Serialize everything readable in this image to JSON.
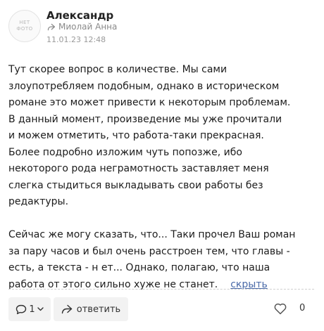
{
  "avatar": {
    "line1": "НЕТ",
    "line2": "ФОТО"
  },
  "post": {
    "author": "Александр",
    "reply_to": "Миолай Анна",
    "date": "11.01.23 12:48",
    "paragraph1": "Тут скорее вопрос в количестве. Мы сами\nзлоупотребляем подобным, однако в историческом\nромане это может привести к некоторым проблемам.\nВ данный момент, произведение мы уже прочитали\nи можем отметить, что работа-таки прекрасная.\nБолее подробно изложим чуть попозже, ибо\nнекоторого рода неграмотность заставляет меня\nслегка стыдиться выкладывать свои работы без\nредактуры.",
    "paragraph2": "Сейчас же могу сказать, что... Таки прочел Ваш роман\nза пару часов и был очень расстроен тем, что главы -\nесть, а текста - н ет... Однако, полагаю, что наша\nработа от этого сильно хуже не станет.",
    "hide_label": "скрыть"
  },
  "actions": {
    "comments_count": "1",
    "reply_label": "ответить",
    "likes_count": "0"
  },
  "icons": {
    "reply_to": "reply-arrow-icon",
    "comments": "speech-bubble-icon",
    "dropdown": "chevron-down-icon",
    "reply": "share-arrow-icon",
    "like": "heart-icon"
  },
  "colors": {
    "link": "#4a6aa8",
    "button_bg": "#f2f2f2",
    "muted": "#8a8a8a"
  }
}
